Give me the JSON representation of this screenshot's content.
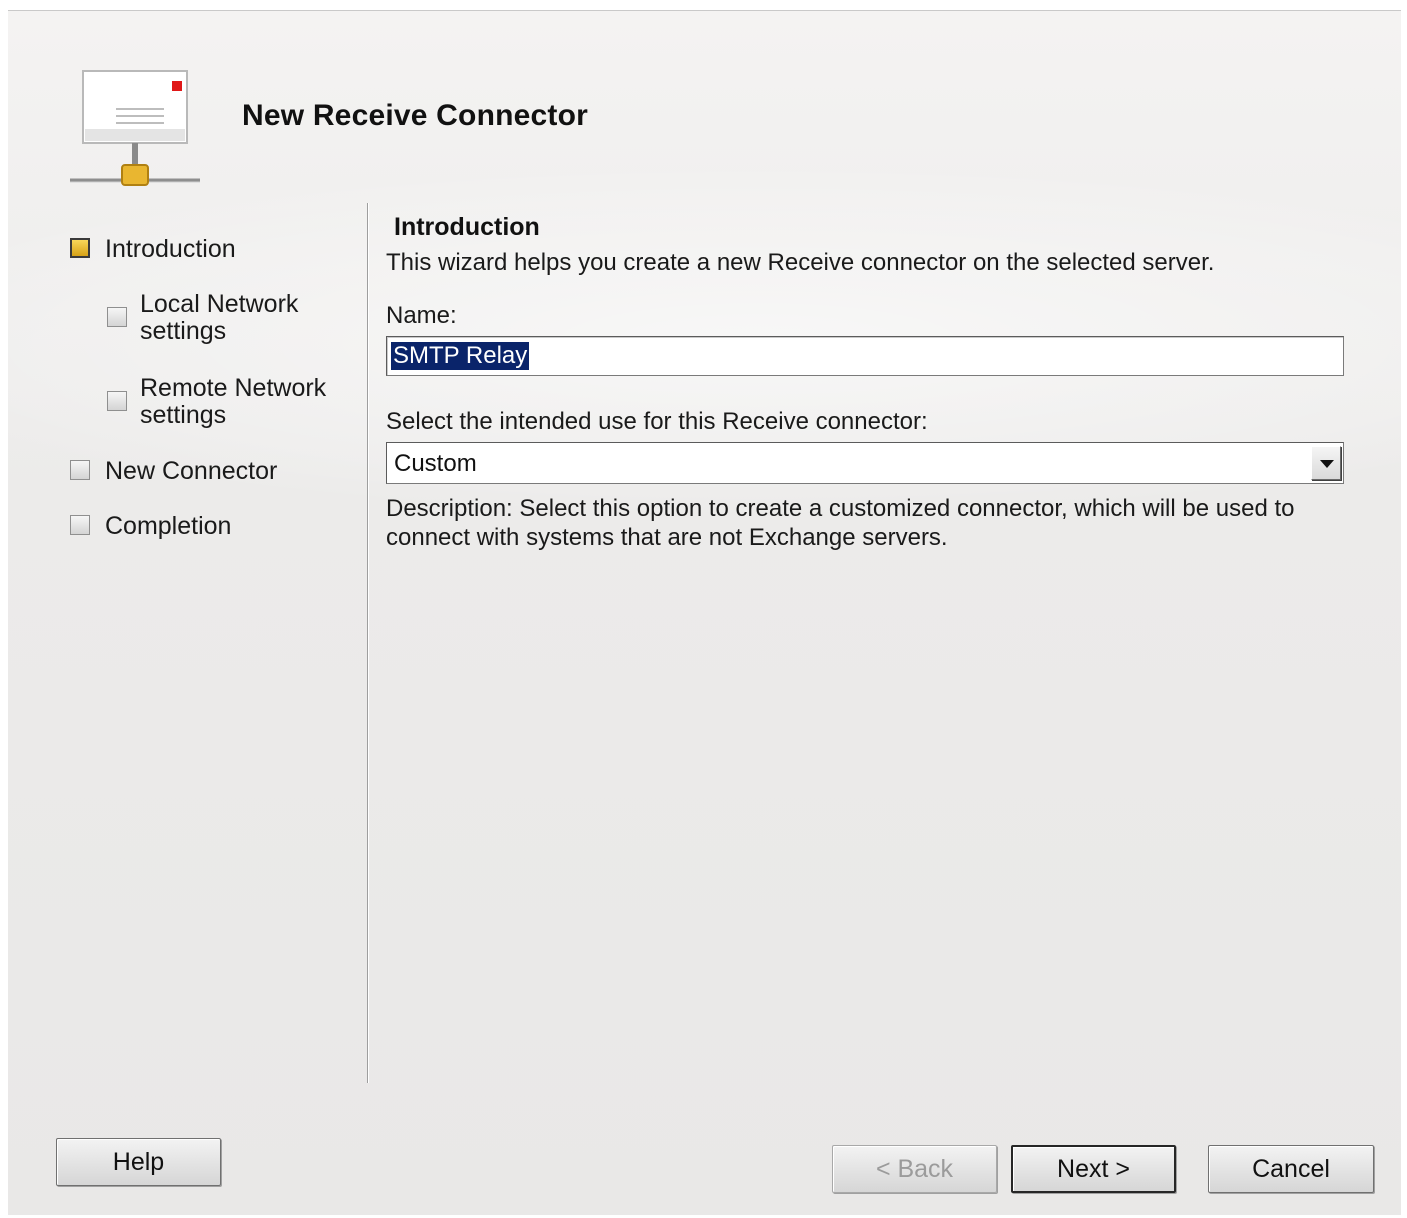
{
  "wizard": {
    "title": "New Receive Connector"
  },
  "nav": {
    "items": [
      {
        "label": "Introduction",
        "active": true
      },
      {
        "label_line1": "Local Network",
        "label_line2": "settings",
        "active": false
      },
      {
        "label_line1": "Remote Network",
        "label_line2": "settings",
        "active": false
      },
      {
        "label": "New Connector",
        "active": false
      },
      {
        "label": "Completion",
        "active": false
      }
    ]
  },
  "page": {
    "section_title": "Introduction",
    "intro_text": "This wizard helps you create a new Receive connector on the selected server.",
    "name_label": "Name:",
    "name_value": "SMTP Relay",
    "use_label": "Select the intended use for this Receive connector:",
    "use_value": "Custom",
    "description_line1": "Description: Select this option to create a customized connector, which will be used to",
    "description_line2": "connect with systems that are not Exchange servers."
  },
  "buttons": {
    "help": "Help",
    "back": "< Back",
    "next": "Next >",
    "cancel": "Cancel"
  },
  "icons": {
    "header": "mail-connector-icon",
    "dropdown": "chevron-down-icon"
  },
  "colors": {
    "active_step": "#e8b92a",
    "selection": "#0a246a"
  }
}
